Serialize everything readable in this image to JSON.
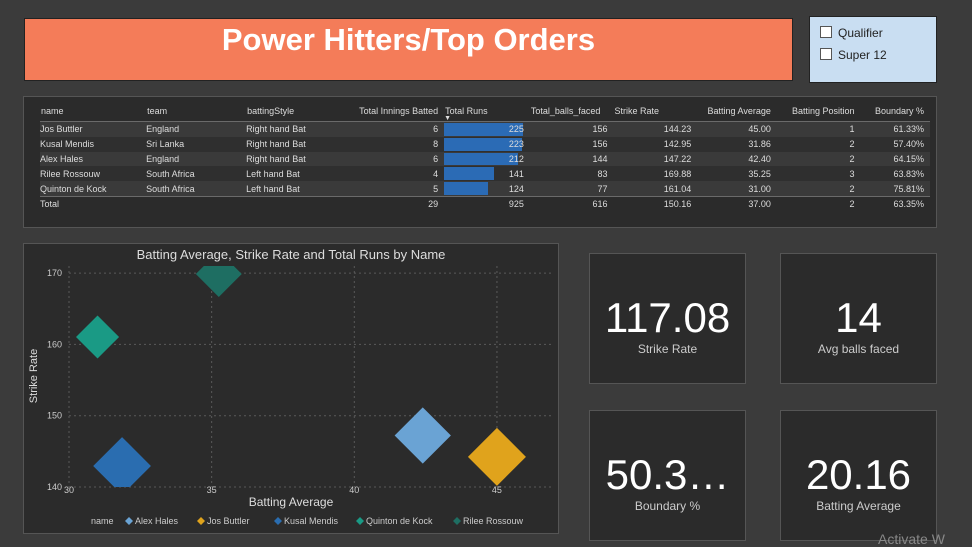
{
  "title": "Power Hitters/Top Orders",
  "filters": [
    {
      "label": "Qualifier",
      "checked": false
    },
    {
      "label": "Super 12",
      "checked": false
    }
  ],
  "table": {
    "headers": [
      "name",
      "team",
      "battingStyle",
      "Total Innings Batted",
      "Total Runs",
      "Total_balls_faced",
      "Strike Rate",
      "Batting Average",
      "Batting Position",
      "Boundary %"
    ],
    "rows": [
      {
        "name": "Jos Buttler",
        "team": "England",
        "style": "Right hand Bat",
        "innings": "6",
        "runs": 225,
        "balls": "156",
        "sr": "144.23",
        "avg": "45.00",
        "pos": "1",
        "boundary": "61.33%"
      },
      {
        "name": "Kusal Mendis",
        "team": "Sri Lanka",
        "style": "Right hand Bat",
        "innings": "8",
        "runs": 223,
        "balls": "156",
        "sr": "142.95",
        "avg": "31.86",
        "pos": "2",
        "boundary": "57.40%"
      },
      {
        "name": "Alex Hales",
        "team": "England",
        "style": "Right hand Bat",
        "innings": "6",
        "runs": 212,
        "balls": "144",
        "sr": "147.22",
        "avg": "42.40",
        "pos": "2",
        "boundary": "64.15%"
      },
      {
        "name": "Rilee Rossouw",
        "team": "South Africa",
        "style": "Left hand Bat",
        "innings": "4",
        "runs": 141,
        "balls": "83",
        "sr": "169.88",
        "avg": "35.25",
        "pos": "3",
        "boundary": "63.83%"
      },
      {
        "name": "Quinton de Kock",
        "team": "South Africa",
        "style": "Left hand Bat",
        "innings": "5",
        "runs": 124,
        "balls": "77",
        "sr": "161.04",
        "avg": "31.00",
        "pos": "2",
        "boundary": "75.81%"
      }
    ],
    "total": {
      "name": "Total",
      "innings": "29",
      "runs": "925",
      "balls": "616",
      "sr": "150.16",
      "avg": "37.00",
      "pos": "2",
      "boundary": "63.35%"
    },
    "runs_max": 225
  },
  "chart_data": {
    "type": "scatter",
    "title": "Batting Average, Strike Rate and Total Runs by Name",
    "xlabel": "Batting Average",
    "ylabel": "Strike Rate",
    "xlim": [
      30,
      47
    ],
    "ylim": [
      140,
      171
    ],
    "xticks": [
      "30",
      "35",
      "40",
      "45"
    ],
    "yticks": [
      "140",
      "150",
      "160",
      "170"
    ],
    "legend_title": "name",
    "legend_position": "bottom",
    "series": [
      {
        "name": "Alex Hales",
        "color": "#6aa3d4",
        "x": 42.4,
        "y": 147.22,
        "size": 212
      },
      {
        "name": "Jos Buttler",
        "color": "#e0a31c",
        "x": 45.0,
        "y": 144.23,
        "size": 225
      },
      {
        "name": "Kusal Mendis",
        "color": "#2a6db0",
        "x": 31.86,
        "y": 142.95,
        "size": 223
      },
      {
        "name": "Quinton de Kock",
        "color": "#1a9a85",
        "x": 31.0,
        "y": 161.04,
        "size": 124
      },
      {
        "name": "Rilee Rossouw",
        "color": "#1e6e62",
        "x": 35.25,
        "y": 169.88,
        "size": 141
      }
    ]
  },
  "cards": [
    {
      "value": "117.08",
      "label": "Strike Rate"
    },
    {
      "value": "14",
      "label": "Avg balls faced"
    },
    {
      "value": "50.3…",
      "label": "Boundary %"
    },
    {
      "value": "20.16",
      "label": "Batting Average"
    }
  ],
  "watermark": "Activate W"
}
